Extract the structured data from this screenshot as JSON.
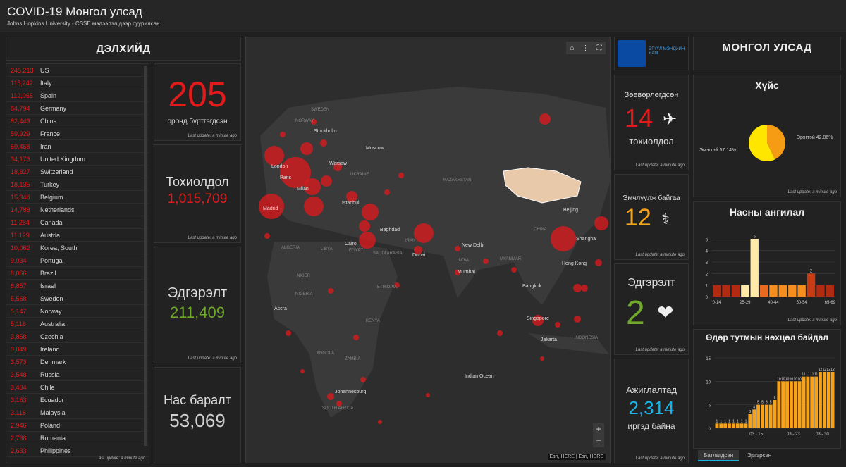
{
  "header": {
    "title": "COVID-19 Монгол улсад",
    "subtitle": "Johns Hopkins University - CSSE мэдээлэл дээр суурилсан"
  },
  "world_header": "ДЭЛХИЙД",
  "mongolia_header": "МОНГОЛ УЛСАД",
  "last_update": "Last update: a minute ago",
  "countries": [
    {
      "num": "245,213",
      "name": "US"
    },
    {
      "num": "115,242",
      "name": "Italy"
    },
    {
      "num": "112,065",
      "name": "Spain"
    },
    {
      "num": "84,794",
      "name": "Germany"
    },
    {
      "num": "82,443",
      "name": "China"
    },
    {
      "num": "59,929",
      "name": "France"
    },
    {
      "num": "50,468",
      "name": "Iran"
    },
    {
      "num": "34,173",
      "name": "United Kingdom"
    },
    {
      "num": "18,827",
      "name": "Switzerland"
    },
    {
      "num": "18,135",
      "name": "Turkey"
    },
    {
      "num": "15,348",
      "name": "Belgium"
    },
    {
      "num": "14,788",
      "name": "Netherlands"
    },
    {
      "num": "11,284",
      "name": "Canada"
    },
    {
      "num": "11,129",
      "name": "Austria"
    },
    {
      "num": "10,062",
      "name": "Korea, South"
    },
    {
      "num": "9,034",
      "name": "Portugal"
    },
    {
      "num": "8,066",
      "name": "Brazil"
    },
    {
      "num": "6,857",
      "name": "Israel"
    },
    {
      "num": "5,568",
      "name": "Sweden"
    },
    {
      "num": "5,147",
      "name": "Norway"
    },
    {
      "num": "5,116",
      "name": "Australia"
    },
    {
      "num": "3,858",
      "name": "Czechia"
    },
    {
      "num": "3,849",
      "name": "Ireland"
    },
    {
      "num": "3,573",
      "name": "Denmark"
    },
    {
      "num": "3,548",
      "name": "Russia"
    },
    {
      "num": "3,404",
      "name": "Chile"
    },
    {
      "num": "3,163",
      "name": "Ecuador"
    },
    {
      "num": "3,116",
      "name": "Malaysia"
    },
    {
      "num": "2,946",
      "name": "Poland"
    },
    {
      "num": "2,738",
      "name": "Romania"
    },
    {
      "num": "2,633",
      "name": "Philippines"
    }
  ],
  "stats": {
    "countries_value": "205",
    "countries_label": "оронд бүртгэгдсэн",
    "cases_label": "Тохиолдол",
    "cases_value": "1,015,709",
    "recovered_label": "Эдгэрэлт",
    "recovered_value": "211,409",
    "deaths_label": "Нас баралт",
    "deaths_value": "53,069"
  },
  "mongolia": {
    "imported_label": "Зөөвөрлөгдсөн",
    "imported_value": "14",
    "imported_sub": "тохиолдол",
    "treated_label": "Эмчлүүлж байгаа",
    "treated_value": "12",
    "recovered_label": "Эдгэрэлт",
    "recovered_value": "2",
    "observed_label": "Ажиглалтад",
    "observed_value": "2,314",
    "observed_sub": "иргэд байна",
    "logo_text": "ЭРҮҮЛ МЭНДИЙН ЯАМ",
    "logo_sub": "ЭРҮҮЛ МЭНДИЙН ХӨГЖЛИЙН"
  },
  "map": {
    "labels": [
      {
        "t": "SWEDEN",
        "dim": true
      },
      {
        "t": "NORWAY",
        "dim": true
      },
      {
        "t": "Stockholm"
      },
      {
        "t": "Moscow"
      },
      {
        "t": "London"
      },
      {
        "t": "Warsaw"
      },
      {
        "t": "UKRAINE",
        "dim": true
      },
      {
        "t": "Paris"
      },
      {
        "t": "Milan"
      },
      {
        "t": "Madrid"
      },
      {
        "t": "Istanbul"
      },
      {
        "t": "Baghdad"
      },
      {
        "t": "Cairo"
      },
      {
        "t": "Dubai"
      },
      {
        "t": "SAUDI ARABIA",
        "dim": true
      },
      {
        "t": "New Delhi"
      },
      {
        "t": "Mumbai"
      },
      {
        "t": "INDIA",
        "dim": true
      },
      {
        "t": "Beijing"
      },
      {
        "t": "CHINA",
        "dim": true
      },
      {
        "t": "Shangha"
      },
      {
        "t": "Hong Kong"
      },
      {
        "t": "Bangkok"
      },
      {
        "t": "Singapore"
      },
      {
        "t": "Jakarta"
      },
      {
        "t": "INDONESIA",
        "dim": true
      },
      {
        "t": "ALGERIA",
        "dim": true
      },
      {
        "t": "LIBYA",
        "dim": true
      },
      {
        "t": "EGYPT",
        "dim": true
      },
      {
        "t": "NIGER",
        "dim": true
      },
      {
        "t": "NIGERIA",
        "dim": true
      },
      {
        "t": "ETHIOPIA",
        "dim": true
      },
      {
        "t": "KENYA",
        "dim": true
      },
      {
        "t": "ANGOLA",
        "dim": true
      },
      {
        "t": "ZAMBIA",
        "dim": true
      },
      {
        "t": "Johannesburg"
      },
      {
        "t": "SOUTH AFRICA",
        "dim": true
      },
      {
        "t": "Indian Ocean"
      },
      {
        "t": "KAZAKHSTAN",
        "dim": true
      },
      {
        "t": "IRAN",
        "dim": true
      },
      {
        "t": "MYANMAR",
        "dim": true
      },
      {
        "t": "Accra"
      }
    ],
    "attribution": "Esri, HERE | Esri, HERE",
    "zoom_in": "+",
    "zoom_out": "−"
  },
  "gender_chart": {
    "title": "Хүйс",
    "labels": [
      "Эрэгтэй 42.86%",
      "Эмэгтэй 57.14%"
    ]
  },
  "age_chart": {
    "title": "Насны ангилал",
    "tick_labels": [
      "0-14",
      "25-29",
      "40-44",
      "50-54",
      "65-69"
    ]
  },
  "daily_chart": {
    "title": "Өдөр тутмын нөхцөл байдал",
    "x_labels": [
      "03 - 15",
      "03 - 23",
      "03 - 30"
    ]
  },
  "tabs": {
    "tab1": "Батлагдсан",
    "tab2": "Эдгэрсэн"
  },
  "chart_data": [
    {
      "type": "pie",
      "title": "Хүйс",
      "categories": [
        "Эрэгтэй",
        "Эмэгтэй"
      ],
      "values": [
        42.86,
        57.14
      ],
      "colors": [
        "#f59b14",
        "#ffe600"
      ]
    },
    {
      "type": "bar",
      "title": "Насны ангилал",
      "categories": [
        "0-14",
        "",
        "",
        "25-29",
        "",
        "",
        "40-44",
        "",
        "",
        "50-54",
        "",
        "",
        "65-69"
      ],
      "values": [
        1,
        1,
        1,
        1,
        5,
        1,
        1,
        1,
        1,
        1,
        2,
        1,
        1
      ],
      "colors": [
        "#b12a12",
        "#b12a12",
        "#b12a12",
        "#ffe9a8",
        "#ffe9a8",
        "#e86a20",
        "#f58d1f",
        "#f58d1f",
        "#f58d1f",
        "#f58d1f",
        "#c93b13",
        "#b12a12",
        "#b12a12"
      ],
      "ylim": [
        0,
        6
      ],
      "yticks": [
        0,
        1,
        2,
        3,
        4,
        5
      ]
    },
    {
      "type": "bar",
      "title": "Өдөр тутмын нөхцөл байдал",
      "values": [
        1,
        1,
        1,
        1,
        1,
        1,
        1,
        1,
        3,
        4,
        5,
        5,
        5,
        5,
        6,
        10,
        10,
        10,
        10,
        10,
        10,
        11,
        11,
        11,
        11,
        12,
        12,
        12,
        12
      ],
      "ylim": [
        0,
        15
      ],
      "yticks": [
        0,
        5,
        10,
        15
      ]
    }
  ]
}
